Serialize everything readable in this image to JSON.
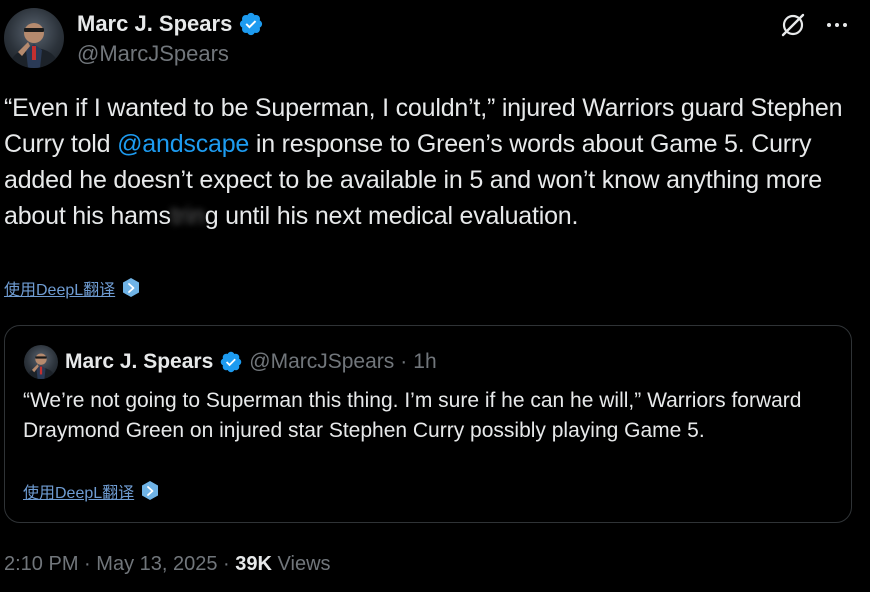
{
  "author": {
    "display_name": "Marc J. Spears",
    "handle": "@MarcJSpears",
    "verified_color": "#1d9bf0"
  },
  "top_icons": [
    "grok-icon",
    "more-icon"
  ],
  "tweet": {
    "text_part1": "“Even if I wanted to be Superman, I couldn’t,” injured Warriors guard Stephen Curry told ",
    "mention": "@andscape",
    "text_part2": " in response to Green’s words about Game 5. Curry added he doesn’t expect to be available in 5 and won’t know anything more about his hams",
    "text_blurred": "trin",
    "text_part3": "g until his next medical evaluation.",
    "translate_label": "使用DeepL翻译"
  },
  "quote": {
    "display_name": "Marc J. Spears",
    "handle": "@MarcJSpears",
    "separator": "·",
    "time": "1h",
    "text": "“We’re not going to Superman this thing. I’m sure if he can he will,” Warriors forward Draymond Green on injured star Stephen Curry possibly playing Game 5.",
    "translate_label": "使用DeepL翻译"
  },
  "meta": {
    "time": "2:10 PM",
    "separator": "·",
    "date": "May 13, 2025",
    "views_count": "39K",
    "views_label": "Views"
  },
  "colors": {
    "background": "#000000",
    "text": "#e7e9ea",
    "secondary": "#71767b",
    "link": "#1d9bf0",
    "translate_link": "#6f9cd2"
  }
}
